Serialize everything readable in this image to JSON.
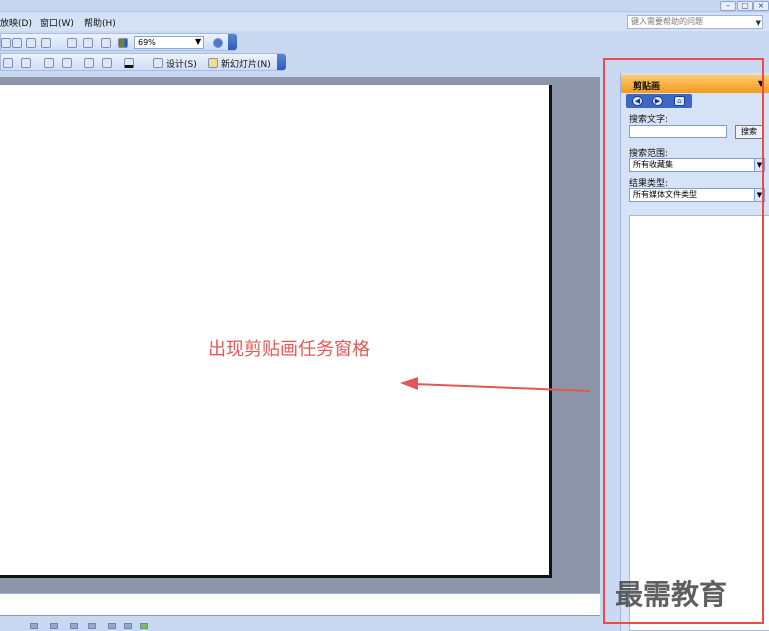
{
  "menu": {
    "items": [
      "放映(D)",
      "窗口(W)",
      "帮助(H)"
    ],
    "help_placeholder": "键入需要帮助的问题"
  },
  "toolbar": {
    "zoom_value": "69%",
    "design_label": "设计(S)",
    "new_slide_label": "新幻灯片(N)"
  },
  "annotation": {
    "text": "出现剪贴画任务窗格",
    "color": "#e55757"
  },
  "task_pane": {
    "title": "剪贴画",
    "search_text_label": "搜索文字:",
    "search_text_value": "",
    "search_button": "搜索",
    "search_scope_label": "搜索范围:",
    "search_scope_value": "所有收藏集",
    "result_type_label": "结果类型:",
    "result_type_value": "所有媒体文件类型"
  },
  "watermark": {
    "text": "最需教育"
  },
  "colors": {
    "highlight": "#ef4a4a",
    "pane_header": "#f29a1c"
  }
}
